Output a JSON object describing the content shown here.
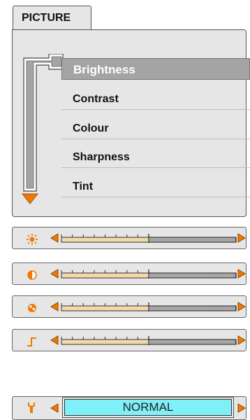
{
  "tab": {
    "title": "PICTURE"
  },
  "menu": {
    "items": [
      {
        "label": "Brightness",
        "selected": true
      },
      {
        "label": "Contrast",
        "selected": false
      },
      {
        "label": "Colour",
        "selected": false
      },
      {
        "label": "Sharpness",
        "selected": false
      },
      {
        "label": "Tint",
        "selected": false
      }
    ]
  },
  "adjustments": [
    {
      "icon": "sun-icon",
      "level": 0.5
    },
    {
      "icon": "contrast-icon",
      "level": 0.5
    },
    {
      "icon": "colour-icon",
      "level": 0.5
    },
    {
      "icon": "sharpness-icon",
      "level": 0.5
    }
  ],
  "tint": {
    "icon": "wrench-icon",
    "value": "NORMAL"
  },
  "colors": {
    "accent": "#f07800",
    "fill": "#f3d8a8",
    "highlight": "#a4a4a4",
    "value_box": "#7ff0f8"
  }
}
